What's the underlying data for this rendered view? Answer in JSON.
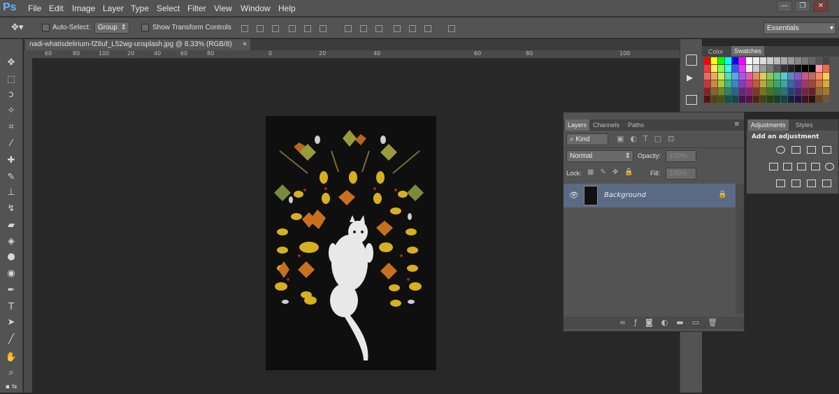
{
  "app": {
    "logo": "Ps"
  },
  "menu": [
    "File",
    "Edit",
    "Image",
    "Layer",
    "Type",
    "Select",
    "Filter",
    "View",
    "Window",
    "Help"
  ],
  "window_controls": {
    "minimize": "—",
    "restore": "❐",
    "close": "✕"
  },
  "options": {
    "auto_select_label": "Auto-Select:",
    "auto_select_mode": "Group",
    "show_transform_label": "Show Transform Controls",
    "workspace": "Essentials"
  },
  "document": {
    "tab_title": "nadi-whatisdelirium-fZ8uf_L52wg-unsplash.jpg @ 8.33% (RGB/8)",
    "close": "×"
  },
  "ruler": {
    "h_labels": [
      "60",
      "80",
      "100",
      "20",
      "40",
      "60",
      "80",
      "20",
      "40",
      "60",
      "80",
      "100"
    ],
    "h_zero": "0",
    "v_labels": [
      "1",
      "0",
      "2",
      "0",
      "3",
      "0",
      "4",
      "0",
      "5",
      "0",
      "6",
      "0",
      "7",
      "0",
      "8",
      "0",
      "9",
      "0",
      "1",
      "0",
      "0",
      "1",
      "1"
    ]
  },
  "swatches_panel": {
    "tabs": [
      "Color",
      "Swatches"
    ]
  },
  "layers_panel": {
    "tabs": [
      "Layers",
      "Channels",
      "Paths"
    ],
    "kind_label": "Kind",
    "blend_mode": "Normal",
    "opacity_label": "Opacity:",
    "opacity_value": "100%",
    "lock_label": "Lock:",
    "fill_label": "Fill:",
    "fill_value": "100%",
    "layer_name": "Background"
  },
  "adjustments_panel": {
    "tabs": [
      "Adjustments",
      "Styles"
    ],
    "heading": "Add an adjustment"
  },
  "colors": {
    "accent": "#6bb0ff",
    "layer_selected": "#5b6a85",
    "panel": "#535353"
  }
}
